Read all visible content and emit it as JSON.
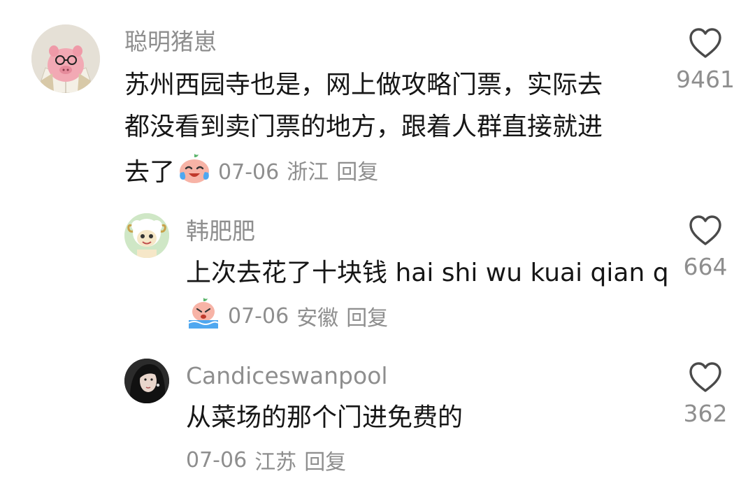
{
  "comments": [
    {
      "username": "聪明猪崽",
      "text_lines": [
        "苏州西园寺也是，网上做攻略门票，实际去",
        "都没看到卖门票的地方，跟着人群直接就进",
        "去了"
      ],
      "date": "07-06",
      "location": "浙江",
      "reply_label": "回复",
      "likes": "9461",
      "avatar_icon": "pig-avatar-icon",
      "emoji_icon": "crying-laughing-emoji-icon"
    },
    {
      "username": "韩肥肥",
      "text_lines": [
        "上次去花了十块钱 hai shi wu kuai qian q"
      ],
      "date": "07-06",
      "location": "安徽",
      "reply_label": "回复",
      "likes": "664",
      "avatar_icon": "cartoon-sheep-avatar-icon",
      "emoji_icon": "crying-emoji-icon"
    },
    {
      "username": "Candiceswanpool",
      "text_lines": [
        "从菜场的那个门进免费的"
      ],
      "date": "07-06",
      "location": "江苏",
      "reply_label": "回复",
      "likes": "362",
      "avatar_icon": "woman-photo-avatar-icon"
    }
  ],
  "colors": {
    "secondary_text": "#8e8e8e",
    "primary_text": "#161616"
  }
}
